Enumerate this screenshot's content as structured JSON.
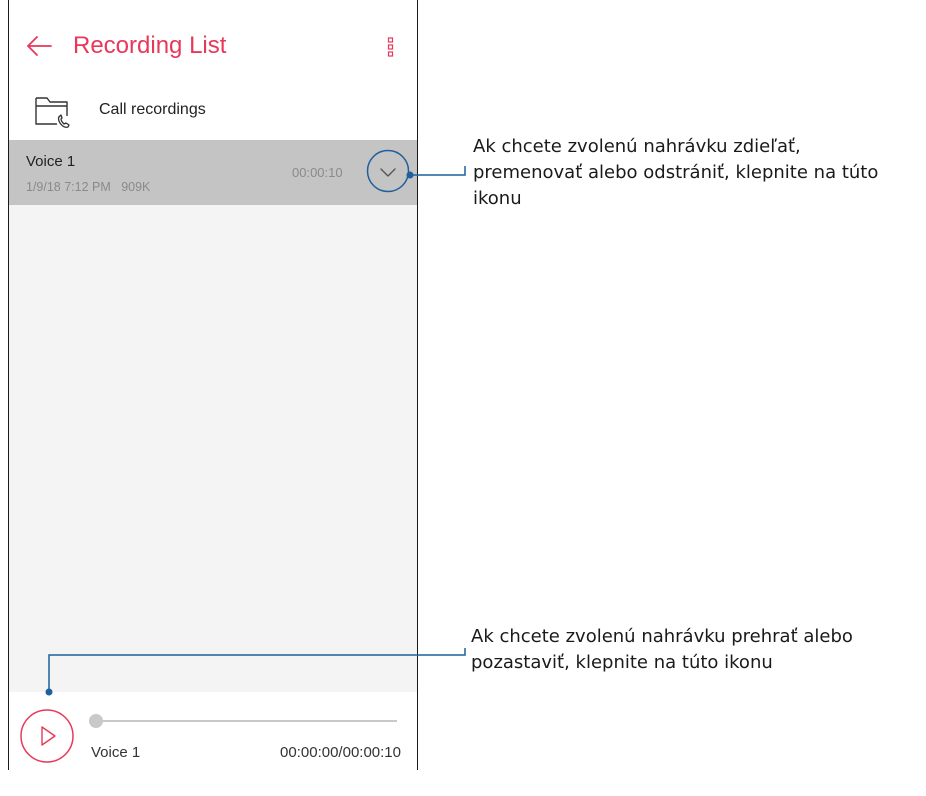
{
  "appbar": {
    "title": "Recording List",
    "back_icon": "arrow-left-icon",
    "menu_icon": "more-vertical-icon"
  },
  "folder": {
    "label": "Call recordings",
    "icon": "folder-phone-icon"
  },
  "recordings": [
    {
      "name": "Voice 1",
      "meta": "1/9/18 7:12 PM   909K",
      "duration": "00:00:10",
      "selected": true
    }
  ],
  "player": {
    "name": "Voice 1",
    "time": "00:00:00/00:00:10",
    "progress": 0
  },
  "callouts": {
    "expand": "Ak chcete zvolenú nahrávku zdieľať, premenovať alebo odstrániť, klepnite na túto ikonu",
    "play": "Ak chcete zvolenú nahrávku prehrať alebo pozastaviť, klepnite na túto ikonu"
  },
  "colors": {
    "accent": "#e8385a",
    "callout_line": "#1f5f9c",
    "selected_row": "#c4c4c4",
    "list_background": "#f4f4f4"
  }
}
